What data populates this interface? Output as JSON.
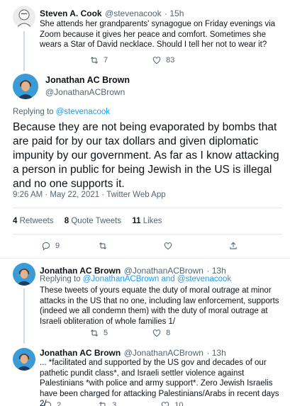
{
  "tweet1": {
    "name": "Steven A. Cook",
    "handle": "@stevenacook",
    "time": "· 15h",
    "text": "She attends her grandparents' synagogue on Friday evenings via Zoom because it gives her peace and comfort.  Sometimes she wears a Star of David necklace.  Should I tell her not to wear it?",
    "retweets": "7",
    "likes": "83"
  },
  "main_tweet": {
    "name": "Jonathan AC Brown",
    "handle": "@JonathanACBrown",
    "replying_label": "Replying to",
    "replying_to": "@stevenacook",
    "text": "Because they are not being evaporated by bombs that are paid for by our tax dollars and given diplomatic impunity by our government. As far as I know attacking a person in public for being Jewish in the US is illegal and no one supports it.",
    "timestamp": "9:26 AM · May 22, 2021 · Twitter Web App",
    "stats": {
      "retweets_count": "4",
      "retweets_label": "Retweets",
      "quotes_count": "8",
      "quotes_label": "Quote Tweets",
      "likes_count": "11",
      "likes_label": "Likes"
    },
    "reply_count": "9"
  },
  "reply1": {
    "name": "Jonathan AC Brown",
    "handle": "@JonathanACBrown",
    "time": "· 13h",
    "replying_label": "Replying to",
    "replying_to": "@JonathanACBrown and @stevenacook",
    "text": "These tweets of yours equate the duty of moral outrage at minor attacks in the US that no one, including law enforcement,  supports (indeed we all condemn them) with the duty of moral outrage at Israeli obliteration of whole families 1/",
    "retweets": "5",
    "likes": "8"
  },
  "reply2": {
    "name": "Jonathan AC Brown",
    "handle": "@JonathanACBrown",
    "time": "· 13h",
    "text": "... *facilitated and supported by the US gov and decades of our pathetic pundit class*, and Israeli settler violence against Palestinians *with police and army support*. Zero Jewish Israelis have been charged for attacking Palestinians/Arabs in recent days 2/",
    "replies": "2",
    "retweets": "3",
    "likes": "10"
  },
  "colors": {
    "accent": "#1d9bf0",
    "secondary_text": "#536471",
    "divider": "#e7ecef"
  }
}
